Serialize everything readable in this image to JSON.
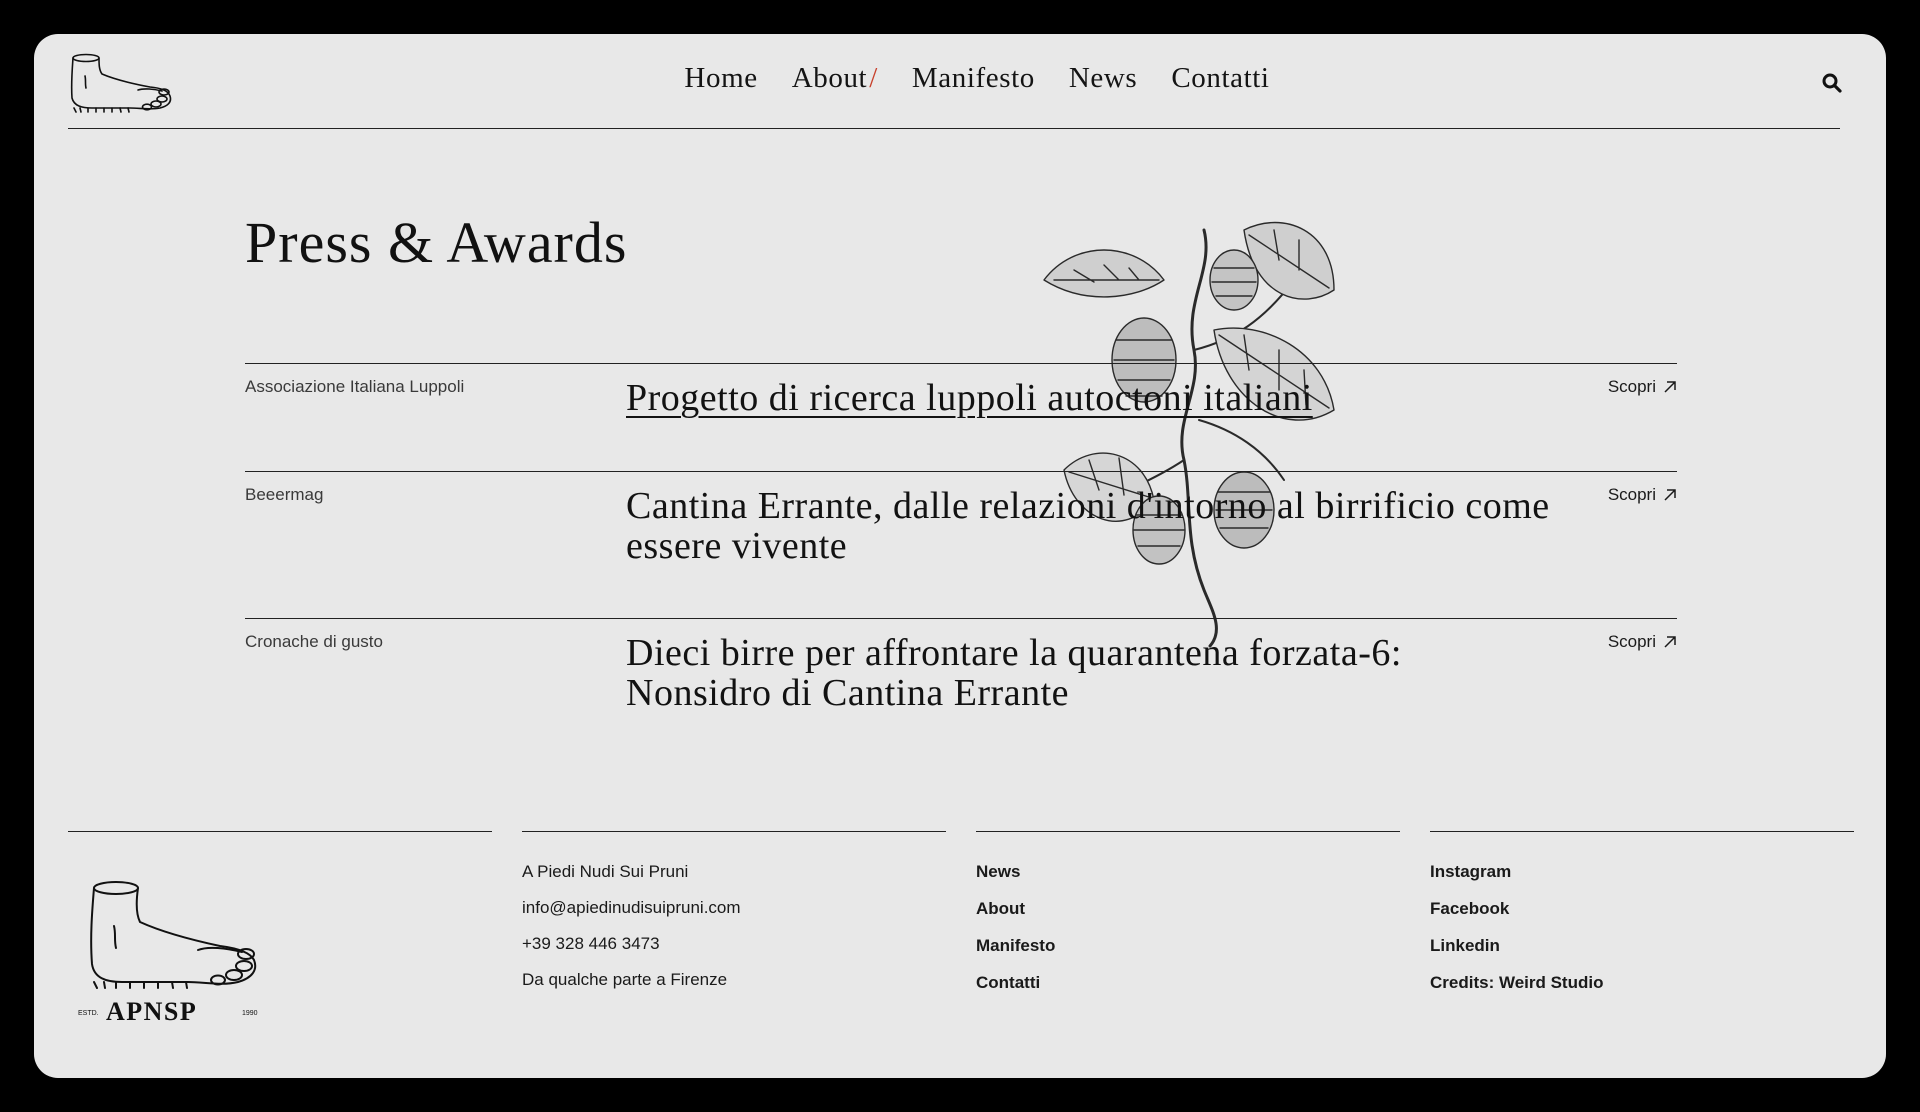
{
  "header": {
    "nav": [
      {
        "label": "Home"
      },
      {
        "label": "About"
      },
      {
        "label": "Manifesto"
      },
      {
        "label": "News"
      },
      {
        "label": "Contatti"
      }
    ],
    "about_slash": "/"
  },
  "main": {
    "title": "Press & Awards",
    "items": [
      {
        "source": "Associazione Italiana Luppoli",
        "headline": "Progetto di ricerca luppoli autoctoni italiani",
        "cta": "Scopri"
      },
      {
        "source": "Beeermag",
        "headline": "Cantina Errante, dalle relazioni d'intorno al birrificio come essere vivente",
        "cta": "Scopri"
      },
      {
        "source": "Cronache di gusto",
        "headline": "Dieci birre per affrontare la quarantena forzata-6: Nonsidro di Cantina Errante",
        "cta": "Scopri"
      }
    ]
  },
  "footer": {
    "logo": {
      "text": "APNSP",
      "estd": "ESTD.",
      "year": "1990"
    },
    "contact": [
      "A Piedi Nudi Sui Pruni",
      "info@apiedinudisuipruni.com",
      "+39 328 446 3473",
      "Da qualche parte a Firenze"
    ],
    "pages": [
      "News",
      "About",
      "Manifesto",
      "Contatti"
    ],
    "social": [
      "Instagram",
      "Facebook",
      "Linkedin",
      "Credits: Weird Studio"
    ]
  },
  "colors": {
    "background": "#e8e8e8",
    "text": "#111111",
    "accent": "#c8412c",
    "frame": "#000000"
  },
  "icons": [
    "foot-logo-icon",
    "search-icon",
    "external-arrow-icon",
    "hops-illustration"
  ]
}
